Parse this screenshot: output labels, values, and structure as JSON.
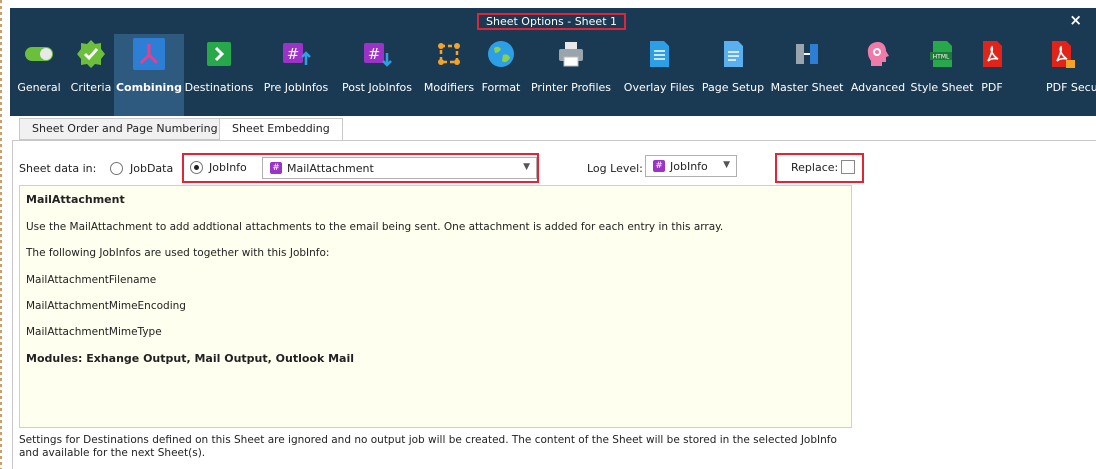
{
  "window": {
    "title": "Sheet Options - Sheet 1",
    "close": "×"
  },
  "toolbar": {
    "items": [
      {
        "label": "General",
        "icon": "toggle-icon",
        "active": false
      },
      {
        "label": "Criteria",
        "icon": "badge-check-icon",
        "active": false
      },
      {
        "label": "Combining",
        "icon": "combine-arrows-icon",
        "active": true
      },
      {
        "label": "Destinations",
        "icon": "arrow-right-box-icon",
        "active": false
      },
      {
        "label": "Pre JobInfos",
        "icon": "hash-up-icon",
        "active": false
      },
      {
        "label": "Post JobInfos",
        "icon": "hash-down-icon",
        "active": false
      },
      {
        "label": "Modifiers",
        "icon": "modifiers-icon",
        "active": false
      },
      {
        "label": "Format",
        "icon": "globe-icon",
        "active": false
      },
      {
        "label": "Printer Profiles",
        "icon": "printer-icon",
        "active": false
      },
      {
        "label": "Overlay Files",
        "icon": "overlay-file-icon",
        "active": false
      },
      {
        "label": "Page Setup",
        "icon": "page-icon",
        "active": false
      },
      {
        "label": "Master Sheet",
        "icon": "master-sheet-icon",
        "active": false
      },
      {
        "label": "Advanced",
        "icon": "head-gear-icon",
        "active": false
      },
      {
        "label": "Style Sheet",
        "icon": "html-file-icon",
        "active": false
      },
      {
        "label": "PDF",
        "icon": "pdf-icon",
        "active": false
      },
      {
        "label": "PDF Security",
        "icon": "pdf-lock-icon",
        "active": false
      }
    ]
  },
  "tabs": [
    {
      "label": "Sheet Order and Page Numbering",
      "selected": false
    },
    {
      "label": "Sheet Embedding",
      "selected": true
    }
  ],
  "embedding": {
    "sheet_data_label": "Sheet data in:",
    "option_jobdata": "JobData",
    "option_jobinfo": "JobInfo",
    "selected_option": "JobInfo",
    "jobinfo_value": "MailAttachment",
    "log_level_label": "Log Level:",
    "log_level_value": "JobInfo",
    "replace_label": "Replace:",
    "replace_checked": false
  },
  "description": {
    "title": "MailAttachment",
    "line1": "Use the MailAttachment to add addtional attachments to the email being sent. One attachment is added for each entry in this array.",
    "line2": "The following JobInfos are used together with this JobInfo:",
    "item1": "MailAttachmentFilename",
    "item2": "MailAttachmentMimeEncoding",
    "item3": "MailAttachmentMimeType",
    "modules": "Modules: Exhange Output, Mail Output, Outlook Mail"
  },
  "footer": {
    "line1": "Settings for Destinations defined on this Sheet are ignored and no output job will be created. The content of the Sheet will be stored in the selected JobInfo",
    "line2": "and available for the next Sheet(s)."
  },
  "colors": {
    "titlebar": "#1a3a54",
    "highlight_box": "#e0243a",
    "description_bg": "#fffff0",
    "jobinfo_icon": "#9b33c9"
  }
}
